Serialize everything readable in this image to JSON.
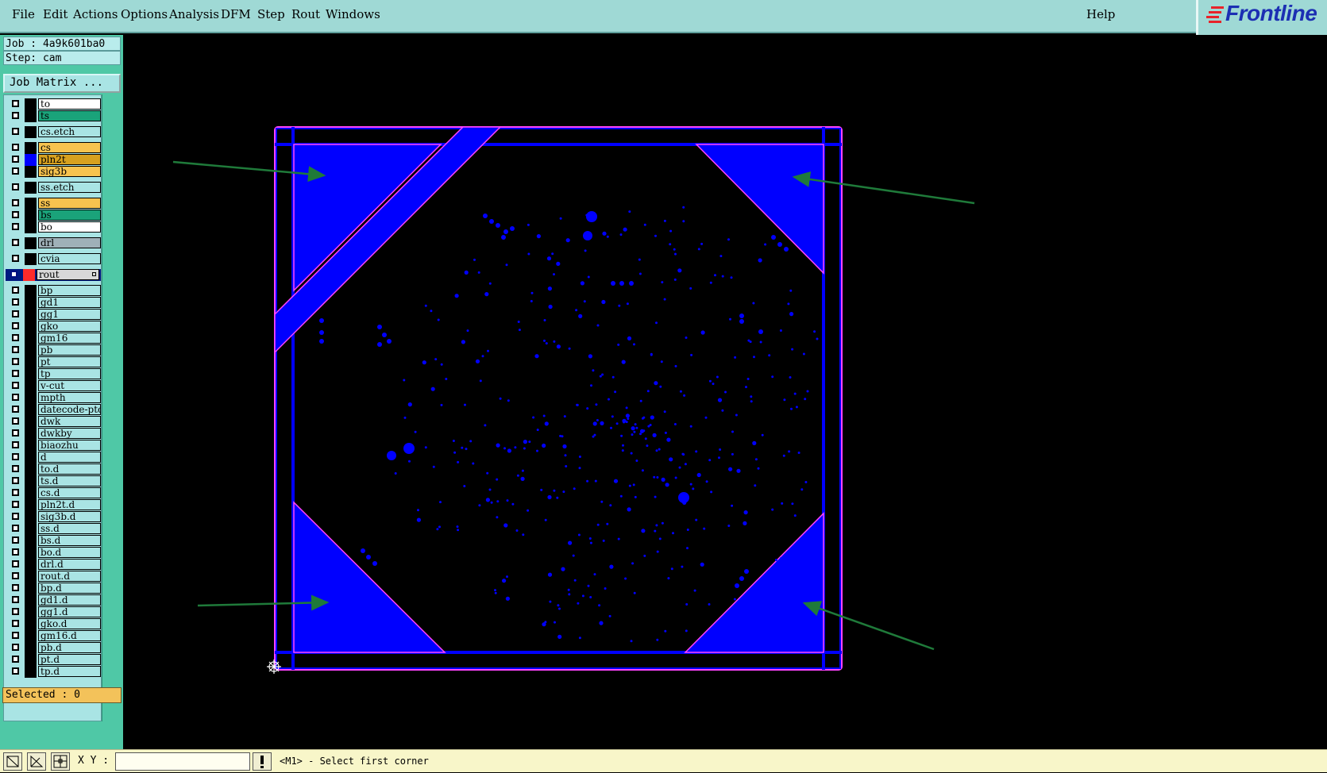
{
  "menu": {
    "file": "File",
    "edit": "Edit",
    "actions": "Actions",
    "options": "Options",
    "analysis": "Analysis",
    "dfm": "DFM",
    "step": "Step",
    "rout": "Rout",
    "windows": "Windows",
    "help": "Help"
  },
  "logo": {
    "text": "Frontline",
    "icon": "frontline-logo"
  },
  "sidebar": {
    "job": "Job : 4a9k601ba0",
    "step": "Step: cam",
    "job_matrix": "Job Matrix ...",
    "selected": "Selected : 0",
    "layers": [
      {
        "name": "to",
        "color": "#ffffff"
      },
      {
        "name": "ts",
        "color": "#1aa37a"
      },
      {
        "name": "cs.etch",
        "color": "#a9e4e4"
      },
      {
        "name": "cs",
        "color": "#f7c34f"
      },
      {
        "name": "pln2t",
        "color": "#d7a11f"
      },
      {
        "name": "sig3b",
        "color": "#f7c34f"
      },
      {
        "name": "ss.etch",
        "color": "#a9e4e4"
      },
      {
        "name": "ss",
        "color": "#f7c34f"
      },
      {
        "name": "bs",
        "color": "#1aa37a"
      },
      {
        "name": "bo",
        "color": "#ffffff"
      },
      {
        "name": "drl",
        "color": "#9fb0b8"
      },
      {
        "name": "cvia",
        "color": "#a9e4e4"
      },
      {
        "name": "rout",
        "color": "#d8d8d8"
      },
      {
        "name": "bp",
        "color": "#a9e4e4"
      },
      {
        "name": "gd1",
        "color": "#a9e4e4"
      },
      {
        "name": "gg1",
        "color": "#a9e4e4"
      },
      {
        "name": "gko",
        "color": "#a9e4e4"
      },
      {
        "name": "gm16",
        "color": "#a9e4e4"
      },
      {
        "name": "pb",
        "color": "#a9e4e4"
      },
      {
        "name": "pt",
        "color": "#a9e4e4"
      },
      {
        "name": "tp",
        "color": "#a9e4e4"
      },
      {
        "name": "v-cut",
        "color": "#a9e4e4"
      },
      {
        "name": "mpth",
        "color": "#a9e4e4"
      },
      {
        "name": "datecode-pto",
        "color": "#a9e4e4"
      },
      {
        "name": "dwk",
        "color": "#a9e4e4"
      },
      {
        "name": "dwkby",
        "color": "#a9e4e4"
      },
      {
        "name": "biaozhu",
        "color": "#a9e4e4"
      },
      {
        "name": "d",
        "color": "#a9e4e4"
      },
      {
        "name": "to.d",
        "color": "#a9e4e4"
      },
      {
        "name": "ts.d",
        "color": "#a9e4e4"
      },
      {
        "name": "cs.d",
        "color": "#a9e4e4"
      },
      {
        "name": "pln2t.d",
        "color": "#a9e4e4"
      },
      {
        "name": "sig3b.d",
        "color": "#a9e4e4"
      },
      {
        "name": "ss.d",
        "color": "#a9e4e4"
      },
      {
        "name": "bs.d",
        "color": "#a9e4e4"
      },
      {
        "name": "bo.d",
        "color": "#a9e4e4"
      },
      {
        "name": "drl.d",
        "color": "#a9e4e4"
      },
      {
        "name": "rout.d",
        "color": "#a9e4e4"
      },
      {
        "name": "bp.d",
        "color": "#a9e4e4"
      },
      {
        "name": "gd1.d",
        "color": "#a9e4e4"
      },
      {
        "name": "gg1.d",
        "color": "#a9e4e4"
      },
      {
        "name": "gko.d",
        "color": "#a9e4e4"
      },
      {
        "name": "gm16.d",
        "color": "#a9e4e4"
      },
      {
        "name": "pb.d",
        "color": "#a9e4e4"
      },
      {
        "name": "pt.d",
        "color": "#a9e4e4"
      },
      {
        "name": "tp.d",
        "color": "#a9e4e4"
      }
    ]
  },
  "status": {
    "xy_label": "X Y :",
    "xy_value": "",
    "prompt": "<M1> - Select first corner"
  },
  "colors": {
    "board_fill": "#0000ff",
    "board_outline": "#ff44ff",
    "arrow": "#1f7a3a",
    "background": "#000000"
  }
}
